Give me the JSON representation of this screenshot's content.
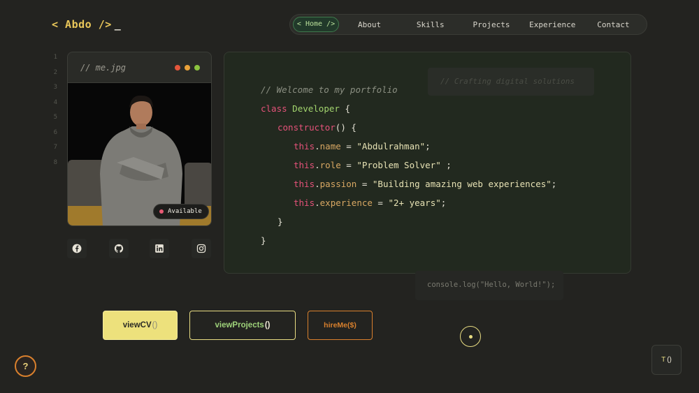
{
  "brand": {
    "logo_text": "< Abdo />",
    "cursor": "_"
  },
  "nav": {
    "items": [
      {
        "label": "< Home />",
        "active": true
      },
      {
        "label": "About"
      },
      {
        "label": "Skills"
      },
      {
        "label": "Projects"
      },
      {
        "label": "Experience"
      },
      {
        "label": "Contact"
      }
    ]
  },
  "line_numbers": [
    "1",
    "2",
    "3",
    "4",
    "5",
    "6",
    "7",
    "8"
  ],
  "profile": {
    "title": "// me.jpg",
    "window_dots": [
      "#e3563b",
      "#e8a13a",
      "#8cc43f"
    ],
    "status": "Available",
    "status_color": "#e85a74"
  },
  "socials": [
    {
      "name": "facebook-icon"
    },
    {
      "name": "github-icon"
    },
    {
      "name": "linkedin-icon"
    },
    {
      "name": "instagram-icon"
    }
  ],
  "code": {
    "comment": "// Welcome to my portfolio",
    "kw_class": "class",
    "class_name": "Developer",
    "brace_open": "{",
    "ctor": "constructor",
    "ctor_tail": "() {",
    "this": "this",
    "dot": ".",
    "name_prop": "name",
    "name_val": "\"Abdulrahman\"",
    "role_prop": "role",
    "role_val": "\"Problem Solver\"",
    "passion_prop": "passion",
    "passion_val": "\"Building amazing web experiences\"",
    "exp_prop": "experience",
    "exp_val": "\"2+ years\"",
    "eq": " = ",
    "semi": ";",
    "semi_sp": " ;",
    "brace_close": "}"
  },
  "floating": {
    "tagline": "// Crafting digital solutions",
    "console": "console.log(\"Hello, World!\");"
  },
  "buttons": {
    "cv": "viewCV",
    "projects": "viewProjects",
    "hire": "hireMe($)",
    "parens": "()"
  },
  "help_label": "?",
  "theme_toggle": {
    "label": "T",
    "parens": "()"
  },
  "colors": {
    "accent_yellow": "#e8dc82",
    "accent_orange": "#d9802d",
    "accent_green": "#9ed27a",
    "background": "#232320"
  }
}
